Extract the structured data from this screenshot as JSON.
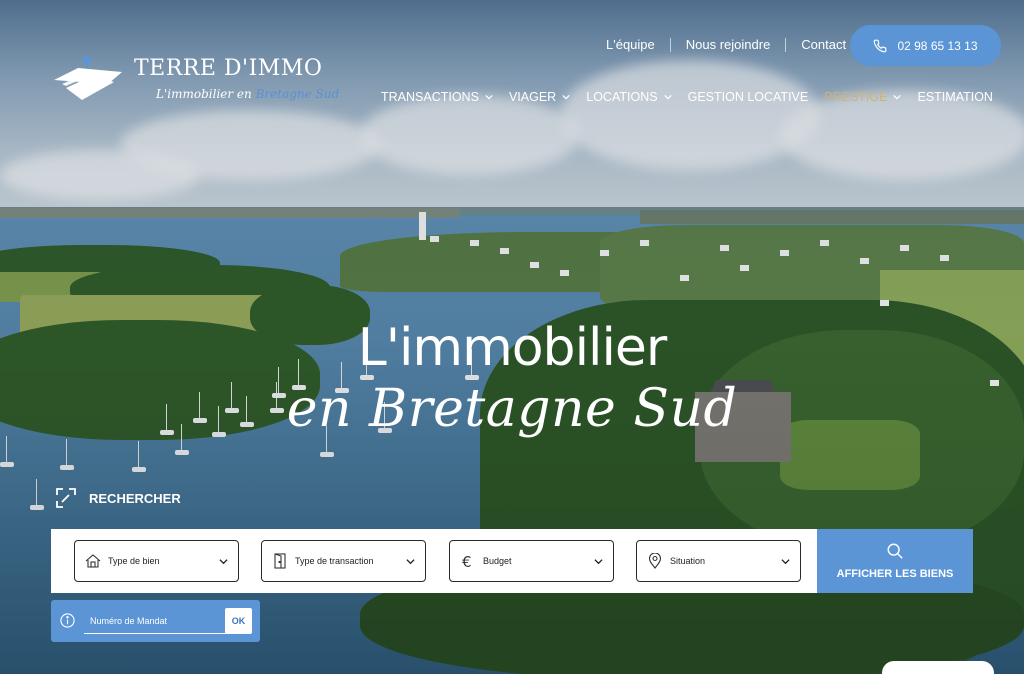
{
  "brand": {
    "name": "TERRE D'IMMO",
    "tagline_prefix": "L'immobilier en ",
    "tagline_highlight": "Bretagne Sud",
    "logo_icon": "house-roof-pin-logo"
  },
  "top_links": [
    "L'équipe",
    "Nous rejoindre",
    "Contact"
  ],
  "phone": {
    "number": "02 98 65 13 13",
    "icon": "phone-icon"
  },
  "nav": [
    {
      "label": "TRANSACTIONS",
      "dropdown": true
    },
    {
      "label": "VIAGER",
      "dropdown": true
    },
    {
      "label": "LOCATIONS",
      "dropdown": true
    },
    {
      "label": "GESTION LOCATIVE",
      "dropdown": false
    },
    {
      "label": "PRESTIGE",
      "dropdown": true
    },
    {
      "label": "ESTIMATION",
      "dropdown": false
    }
  ],
  "hero": {
    "line1": "L'immobilier",
    "line2": "en Bretagne Sud"
  },
  "search": {
    "title": "RECHERCHER",
    "fields": [
      {
        "label": "Type de bien",
        "icon": "house-icon"
      },
      {
        "label": "Type de transaction",
        "icon": "door-icon"
      },
      {
        "label": "Budget",
        "icon": "euro-icon"
      },
      {
        "label": "Situation",
        "icon": "map-pin-icon"
      }
    ],
    "submit_label": "AFFICHER LES BIENS",
    "mandat_placeholder": "Numéro de Mandat",
    "ok_label": "OK"
  },
  "colors": {
    "accent": "#5b95d6",
    "prestige": "#cfb276",
    "white": "#ffffff"
  }
}
